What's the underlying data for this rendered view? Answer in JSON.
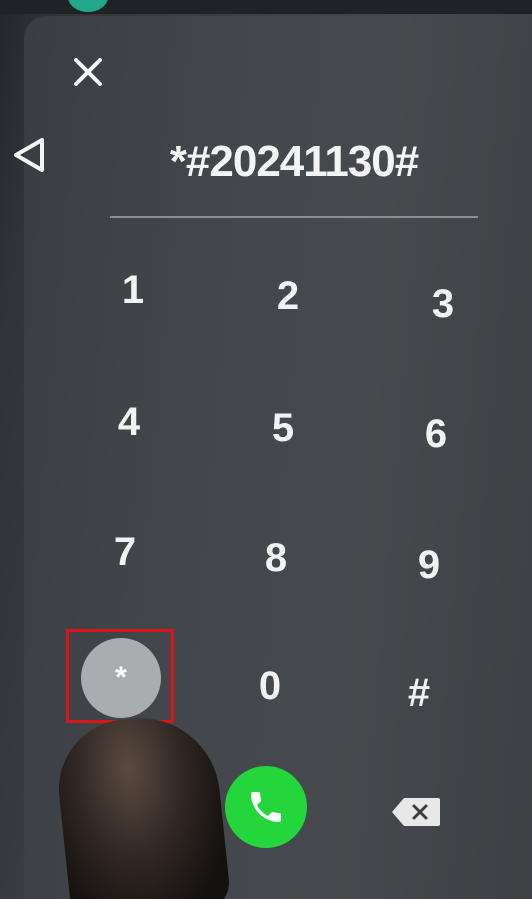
{
  "dialer": {
    "number": "*#20241130#",
    "keys": [
      "1",
      "2",
      "3",
      "4",
      "5",
      "6",
      "7",
      "8",
      "9",
      "*",
      "0",
      "#"
    ],
    "highlighted_key": "*",
    "icons": {
      "close": "close-icon",
      "back": "back-triangle-icon",
      "call": "phone-icon",
      "delete": "backspace-icon"
    }
  },
  "colors": {
    "call_button": "#22d63c",
    "highlight_box": "#d8151c",
    "pressed_key": "#a9adb0",
    "status_indicator": "#1fa88a"
  }
}
